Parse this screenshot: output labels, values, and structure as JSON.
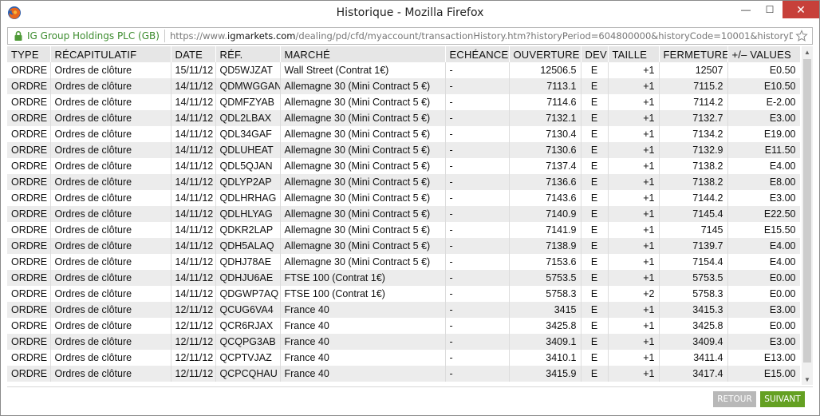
{
  "window": {
    "title": "Historique - Mozilla Firefox",
    "minimize": "—",
    "maximize": "☐",
    "close": "✕"
  },
  "address": {
    "site_identity": "IG Group Holdings PLC (GB)",
    "url_prefix": "https://www.",
    "url_host": "igmarkets.com",
    "url_rest": "/dealing/pd/cfd/myaccount/transactionHistory.htm?historyPeriod=604800000&historyCode=10001&historyDateFrom=TO"
  },
  "columns": [
    "TYPE",
    "RÉCAPITULATIF",
    "DATE",
    "RÉF.",
    "MARCHÉ",
    "ECHÉANCE",
    "OUVERTURE",
    "DEV",
    "TAILLE",
    "FERMETURE",
    "+/– VALUES"
  ],
  "rows": [
    [
      "ORDRE",
      "Ordres de clôture",
      "15/11/12",
      "QD5WJZAT",
      "Wall Street (Contrat 1€)",
      "-",
      "12506.5",
      "E",
      "+1",
      "12507",
      "E0.50"
    ],
    [
      "ORDRE",
      "Ordres de clôture",
      "14/11/12",
      "QDMWGGAN",
      "Allemagne 30 (Mini Contract 5 €)",
      "-",
      "7113.1",
      "E",
      "+1",
      "7115.2",
      "E10.50"
    ],
    [
      "ORDRE",
      "Ordres de clôture",
      "14/11/12",
      "QDMFZYAB",
      "Allemagne 30 (Mini Contract 5 €)",
      "-",
      "7114.6",
      "E",
      "+1",
      "7114.2",
      "E-2.00"
    ],
    [
      "ORDRE",
      "Ordres de clôture",
      "14/11/12",
      "QDL2LBAX",
      "Allemagne 30 (Mini Contract 5 €)",
      "-",
      "7132.1",
      "E",
      "+1",
      "7132.7",
      "E3.00"
    ],
    [
      "ORDRE",
      "Ordres de clôture",
      "14/11/12",
      "QDL34GAF",
      "Allemagne 30 (Mini Contract 5 €)",
      "-",
      "7130.4",
      "E",
      "+1",
      "7134.2",
      "E19.00"
    ],
    [
      "ORDRE",
      "Ordres de clôture",
      "14/11/12",
      "QDLUHEAT",
      "Allemagne 30 (Mini Contract 5 €)",
      "-",
      "7130.6",
      "E",
      "+1",
      "7132.9",
      "E11.50"
    ],
    [
      "ORDRE",
      "Ordres de clôture",
      "14/11/12",
      "QDL5QJAN",
      "Allemagne 30 (Mini Contract 5 €)",
      "-",
      "7137.4",
      "E",
      "+1",
      "7138.2",
      "E4.00"
    ],
    [
      "ORDRE",
      "Ordres de clôture",
      "14/11/12",
      "QDLYP2AP",
      "Allemagne 30 (Mini Contract 5 €)",
      "-",
      "7136.6",
      "E",
      "+1",
      "7138.2",
      "E8.00"
    ],
    [
      "ORDRE",
      "Ordres de clôture",
      "14/11/12",
      "QDLHRHAG",
      "Allemagne 30 (Mini Contract 5 €)",
      "-",
      "7143.6",
      "E",
      "+1",
      "7144.2",
      "E3.00"
    ],
    [
      "ORDRE",
      "Ordres de clôture",
      "14/11/12",
      "QDLHLYAG",
      "Allemagne 30 (Mini Contract 5 €)",
      "-",
      "7140.9",
      "E",
      "+1",
      "7145.4",
      "E22.50"
    ],
    [
      "ORDRE",
      "Ordres de clôture",
      "14/11/12",
      "QDKR2LAP",
      "Allemagne 30 (Mini Contract 5 €)",
      "-",
      "7141.9",
      "E",
      "+1",
      "7145",
      "E15.50"
    ],
    [
      "ORDRE",
      "Ordres de clôture",
      "14/11/12",
      "QDH5ALAQ",
      "Allemagne 30 (Mini Contract 5 €)",
      "-",
      "7138.9",
      "E",
      "+1",
      "7139.7",
      "E4.00"
    ],
    [
      "ORDRE",
      "Ordres de clôture",
      "14/11/12",
      "QDHJ78AE",
      "Allemagne 30 (Mini Contract 5 €)",
      "-",
      "7153.6",
      "E",
      "+1",
      "7154.4",
      "E4.00"
    ],
    [
      "ORDRE",
      "Ordres de clôture",
      "14/11/12",
      "QDHJU6AE",
      "FTSE 100 (Contrat 1€)",
      "-",
      "5753.5",
      "E",
      "+1",
      "5753.5",
      "E0.00"
    ],
    [
      "ORDRE",
      "Ordres de clôture",
      "14/11/12",
      "QDGWP7AQ",
      "FTSE 100 (Contrat 1€)",
      "-",
      "5758.3",
      "E",
      "+2",
      "5758.3",
      "E0.00"
    ],
    [
      "ORDRE",
      "Ordres de clôture",
      "12/11/12",
      "QCUG6VA4",
      "France 40",
      "-",
      "3415",
      "E",
      "+1",
      "3415.3",
      "E3.00"
    ],
    [
      "ORDRE",
      "Ordres de clôture",
      "12/11/12",
      "QCR6RJAX",
      "France 40",
      "-",
      "3425.8",
      "E",
      "+1",
      "3425.8",
      "E0.00"
    ],
    [
      "ORDRE",
      "Ordres de clôture",
      "12/11/12",
      "QCQPG3AB",
      "France 40",
      "-",
      "3409.1",
      "E",
      "+1",
      "3409.4",
      "E3.00"
    ],
    [
      "ORDRE",
      "Ordres de clôture",
      "12/11/12",
      "QCPTVJAZ",
      "France 40",
      "-",
      "3410.1",
      "E",
      "+1",
      "3411.4",
      "E13.00"
    ],
    [
      "ORDRE",
      "Ordres de clôture",
      "12/11/12",
      "QCPCQHAU",
      "France 40",
      "-",
      "3415.9",
      "E",
      "+1",
      "3417.4",
      "E15.00"
    ]
  ],
  "footer": {
    "retour_label": "RETOUR",
    "suivant_label": "SUIVANT"
  },
  "colors": {
    "suivant_bg": "#64a022",
    "retour_bg": "#b8b8b8",
    "close_bg": "#c7403a",
    "site_identity": "#3d8c2f"
  },
  "icons": {
    "app": "firefox-icon",
    "lock": "lock-icon",
    "bookmark": "star-icon"
  }
}
